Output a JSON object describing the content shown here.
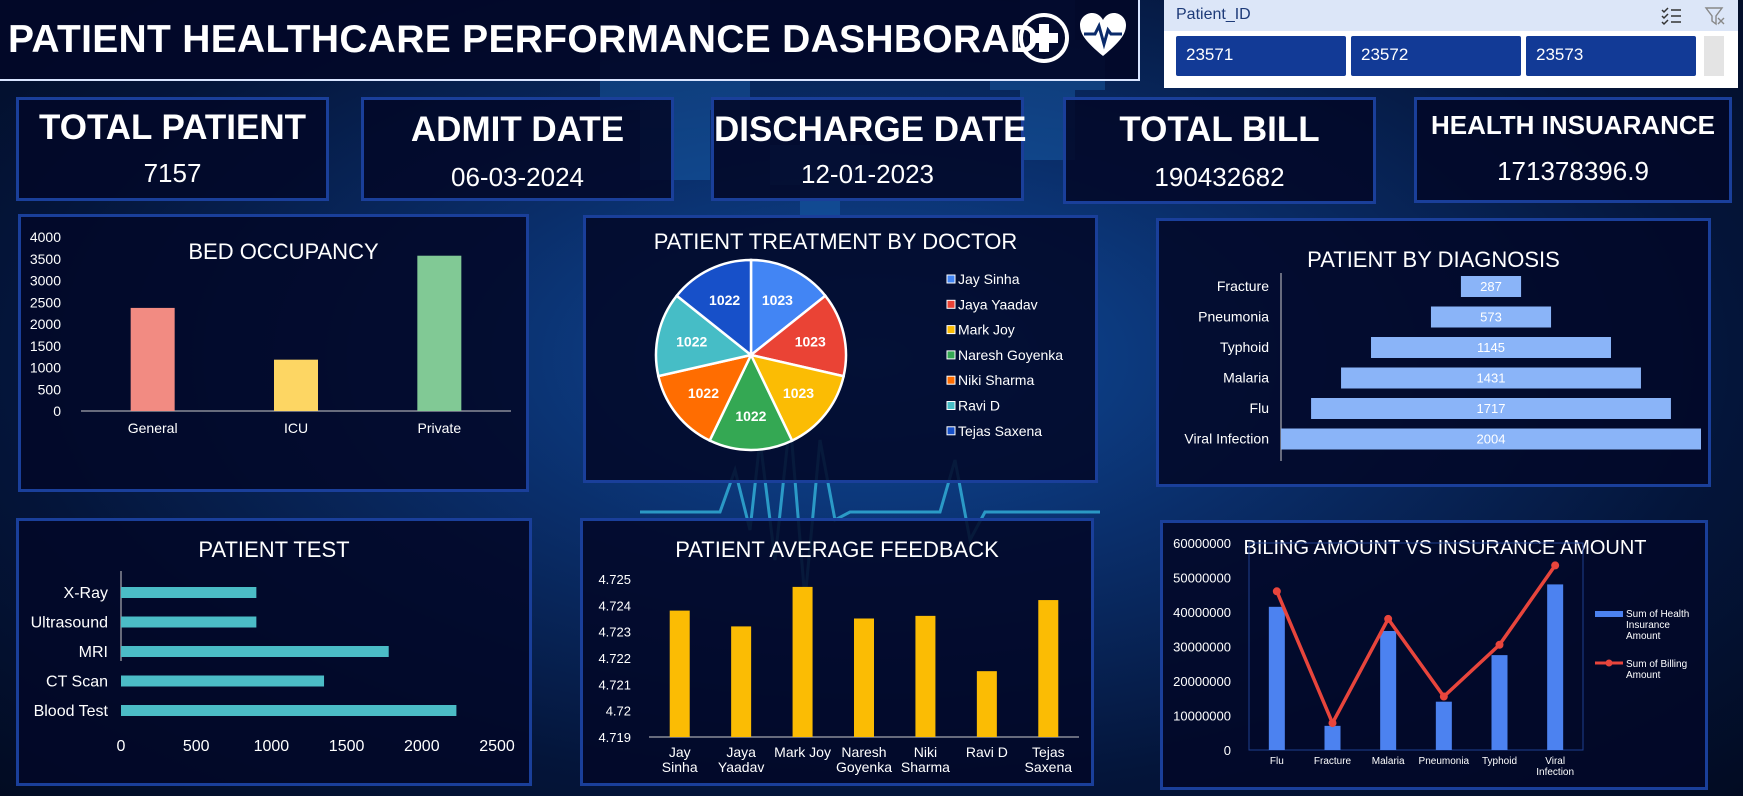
{
  "header": {
    "title": "PATIENT HEALTHCARE PERFORMANCE DASHBORAD"
  },
  "slicer": {
    "title": "Patient_ID",
    "items": [
      "23571",
      "23572",
      "23573"
    ]
  },
  "kpis": [
    {
      "label": "TOTAL PATIENT",
      "value": "7157"
    },
    {
      "label": "ADMIT DATE",
      "value": "06-03-2024"
    },
    {
      "label": "DISCHARGE DATE",
      "value": "12-01-2023"
    },
    {
      "label": "TOTAL BILL",
      "value": "190432682"
    },
    {
      "label": "HEALTH INSUARANCE",
      "value": "171378396.9"
    }
  ],
  "colors": {
    "panel_border": "#1a3f9a",
    "bar_general": "#f28b82",
    "bar_icu": "#fdd663",
    "bar_private": "#81c995",
    "test_bar": "#4bbcc6",
    "feedback_bar": "#fbbc04",
    "diagnosis_bar": "#8ab4f8",
    "insurance_bar": "#4c82f0",
    "billing_line": "#e8453c"
  },
  "chart_data": [
    {
      "id": "bed",
      "type": "bar",
      "title": "BED OCCUPANCY",
      "categories": [
        "General",
        "ICU",
        "Private"
      ],
      "values": [
        2370,
        1180,
        3570
      ],
      "colors": [
        "#f28b82",
        "#fdd663",
        "#81c995"
      ],
      "ylim": [
        0,
        4000
      ],
      "yticks": [
        "0",
        "500",
        "1000",
        "1500",
        "2000",
        "2500",
        "3000",
        "3500",
        "4000"
      ],
      "grid": false
    },
    {
      "id": "doctor",
      "type": "pie",
      "title": "PATIENT TREATMENT BY DOCTOR",
      "categories": [
        "Jay Sinha",
        "Jaya Yaadav",
        "Mark Joy",
        "Naresh Goyenka",
        "Niki Sharma",
        "Ravi D",
        "Tejas Saxena"
      ],
      "values": [
        1023,
        1023,
        1023,
        1022,
        1022,
        1022,
        1022
      ],
      "labels": [
        "1023",
        "1023",
        "1023",
        "1022",
        "1022",
        "1022",
        "1022"
      ],
      "colors": [
        "#4285f4",
        "#ea4335",
        "#fbbc04",
        "#34a853",
        "#ff6d01",
        "#46bdc6",
        "#1750c9"
      ],
      "legend": "right"
    },
    {
      "id": "diagnosis",
      "type": "bar",
      "orientation": "horizontal-funnel",
      "title": "PATIENT BY DIAGNOSIS",
      "categories": [
        "Fracture",
        "Pneumonia",
        "Typhoid",
        "Malaria",
        "Flu",
        "Viral Infection"
      ],
      "values": [
        287,
        573,
        1145,
        1431,
        1717,
        2004
      ],
      "labels": [
        "287",
        "573",
        "1145",
        "1431",
        "1717",
        "2004"
      ]
    },
    {
      "id": "test",
      "type": "bar",
      "orientation": "horizontal",
      "title": "PATIENT TEST",
      "categories": [
        "X-Ray",
        "Ultrasound",
        "MRI",
        "CT Scan",
        "Blood Test"
      ],
      "values": [
        900,
        900,
        1780,
        1350,
        2230
      ],
      "xlim": [
        0,
        2500
      ],
      "xticks": [
        "0",
        "500",
        "1000",
        "1500",
        "2000",
        "2500"
      ],
      "grid": false
    },
    {
      "id": "feedback",
      "type": "bar",
      "title": "PATIENT AVERAGE FEEDBACK",
      "categories": [
        "Jay Sinha",
        "Jaya Yaadav",
        "Mark Joy",
        "Naresh Goyenka",
        "Niki Sharma",
        "Ravi D",
        "Tejas Saxena"
      ],
      "category_lines": [
        [
          "Jay",
          "Sinha"
        ],
        [
          "Jaya",
          "Yaadav"
        ],
        [
          "Mark Joy"
        ],
        [
          "Naresh",
          "Goyenka"
        ],
        [
          "Niki",
          "Sharma"
        ],
        [
          "Ravi D"
        ],
        [
          "Tejas",
          "Saxena"
        ]
      ],
      "values": [
        4.7238,
        4.7232,
        4.7247,
        4.7235,
        4.7236,
        4.7215,
        4.7242
      ],
      "ylim": [
        4.719,
        4.725
      ],
      "yticks": [
        "4.719",
        "4.72",
        "4.721",
        "4.722",
        "4.723",
        "4.724",
        "4.725"
      ],
      "grid": false
    },
    {
      "id": "billing",
      "type": "bar",
      "title": "BILING AMOUNT VS INSURANCE AMOUNT",
      "categories": [
        "Flu",
        "Fracture",
        "Malaria",
        "Pneumonia",
        "Typhoid",
        "Viral Infection"
      ],
      "category_lines": [
        [
          "Flu"
        ],
        [
          "Fracture"
        ],
        [
          "Malaria"
        ],
        [
          "Pneumonia"
        ],
        [
          "Typhoid"
        ],
        [
          "Viral",
          "Infection"
        ]
      ],
      "series": [
        {
          "name": "Sum of Health Insurance Amount",
          "type": "bar",
          "values": [
            41500000,
            7000000,
            34500000,
            14000000,
            27500000,
            48000000
          ]
        },
        {
          "name": "Sum of Billing Amount",
          "type": "line",
          "values": [
            46000000,
            7800000,
            38000000,
            15500000,
            30500000,
            53500000
          ]
        }
      ],
      "legend_lines": [
        [
          "Sum of Health",
          "Insurance",
          "Amount"
        ],
        [
          "Sum of Billing",
          "Amount"
        ]
      ],
      "ylim": [
        0,
        60000000
      ],
      "yticks": [
        "0",
        "10000000",
        "20000000",
        "30000000",
        "40000000",
        "50000000",
        "60000000"
      ],
      "legend": "right",
      "grid": false
    }
  ]
}
